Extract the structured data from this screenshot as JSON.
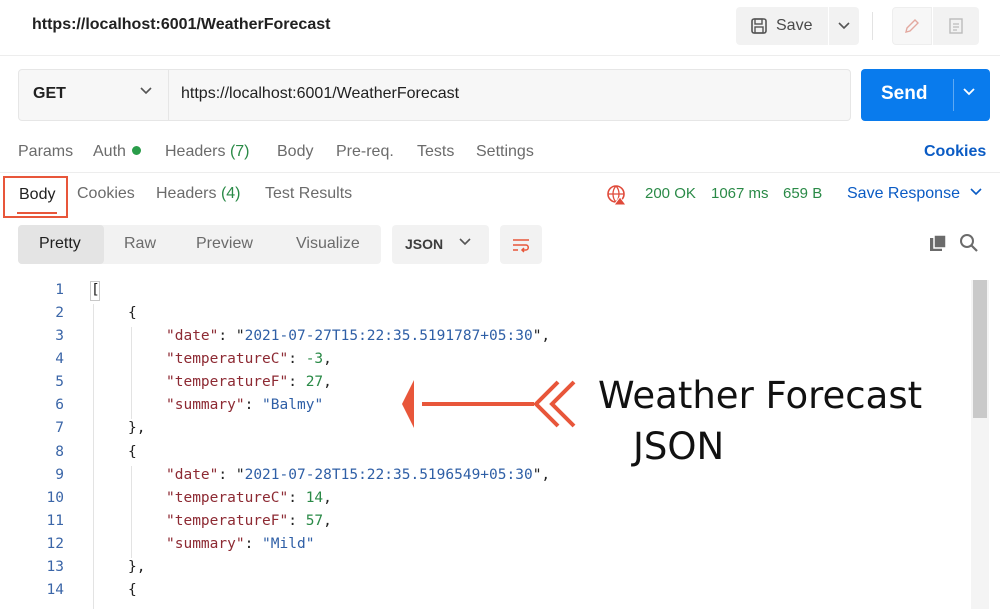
{
  "topbar": {
    "url": "https://localhost:6001/WeatherForecast",
    "save_label": "Save"
  },
  "request": {
    "method": "GET",
    "url": "https://localhost:6001/WeatherForecast",
    "send_label": "Send",
    "tabs": {
      "params": "Params",
      "auth": "Auth",
      "headers": "Headers",
      "headers_count": "(7)",
      "body": "Body",
      "prereq": "Pre-req.",
      "tests": "Tests",
      "settings": "Settings"
    },
    "cookies_link": "Cookies"
  },
  "response": {
    "tabs": {
      "body": "Body",
      "cookies": "Cookies",
      "headers": "Headers",
      "headers_count": "(4)",
      "test_results": "Test Results"
    },
    "status": "200 OK",
    "time": "1067 ms",
    "size": "659 B",
    "save_response": "Save Response",
    "view_modes": [
      "Pretty",
      "Raw",
      "Preview",
      "Visualize"
    ],
    "format": "JSON"
  },
  "code": {
    "line_numbers": [
      "1",
      "2",
      "3",
      "4",
      "5",
      "6",
      "7",
      "8",
      "9",
      "10",
      "11",
      "12",
      "13",
      "14"
    ],
    "items": [
      {
        "date": "2021-07-27T15:22:35.5191787+05:30",
        "temperatureC": "-3",
        "temperatureF": "27",
        "summary": "Balmy"
      },
      {
        "date": "2021-07-28T15:22:35.5196549+05:30",
        "temperatureC": "14",
        "temperatureF": "57",
        "summary": "Mild"
      }
    ],
    "keys": {
      "date": "\"date\"",
      "temperatureC": "\"temperatureC\"",
      "temperatureF": "\"temperatureF\"",
      "summary": "\"summary\""
    }
  },
  "annotation": {
    "line1": "Weather Forecast",
    "line2": "JSON",
    "color": "#e8563a"
  },
  "colors": {
    "accent_blue": "#097bed",
    "status_green": "#2a8a47",
    "highlight_orange": "#e8563a"
  }
}
